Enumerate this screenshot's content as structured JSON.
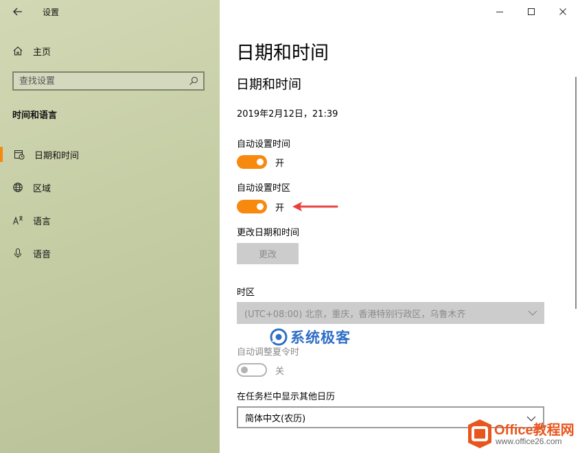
{
  "window": {
    "title": "设置",
    "controls": {
      "minimize_icon": "minimize-icon",
      "maximize_icon": "maximize-icon",
      "close_icon": "close-icon"
    }
  },
  "sidebar": {
    "home_label": "主页",
    "search_placeholder": "查找设置",
    "section_heading": "时间和语言",
    "items": [
      {
        "label": "日期和时间",
        "icon": "calendar-clock-icon",
        "active": true
      },
      {
        "label": "区域",
        "icon": "globe-icon",
        "active": false
      },
      {
        "label": "语言",
        "icon": "language-icon",
        "active": false
      },
      {
        "label": "语音",
        "icon": "microphone-icon",
        "active": false
      }
    ]
  },
  "main": {
    "page_title": "日期和时间",
    "sub_title": "日期和时间",
    "current_datetime": "2019年2月12日，21:39",
    "auto_time": {
      "label": "自动设置时间",
      "state": "开",
      "on": true
    },
    "auto_timezone": {
      "label": "自动设置时区",
      "state": "开",
      "on": true
    },
    "change_datetime": {
      "label": "更改日期和时间",
      "button": "更改"
    },
    "timezone": {
      "label": "时区",
      "value": "(UTC+08:00) 北京，重庆，香港特别行政区，乌鲁木齐"
    },
    "dst": {
      "label": "自动调整夏令时",
      "state": "关",
      "on": false
    },
    "taskbar_calendar": {
      "label": "在任务栏中显示其他日历",
      "value": "简体中文(农历)"
    }
  },
  "overlay": {
    "watermark_text": "系统极客",
    "logo_line1": "Office教程网",
    "logo_line2": "www.office26.com"
  },
  "colors": {
    "accent": "#f7890f",
    "annotation_arrow": "#e8403c",
    "watermark": "#2f6fc6",
    "logo": "#e9561d"
  }
}
